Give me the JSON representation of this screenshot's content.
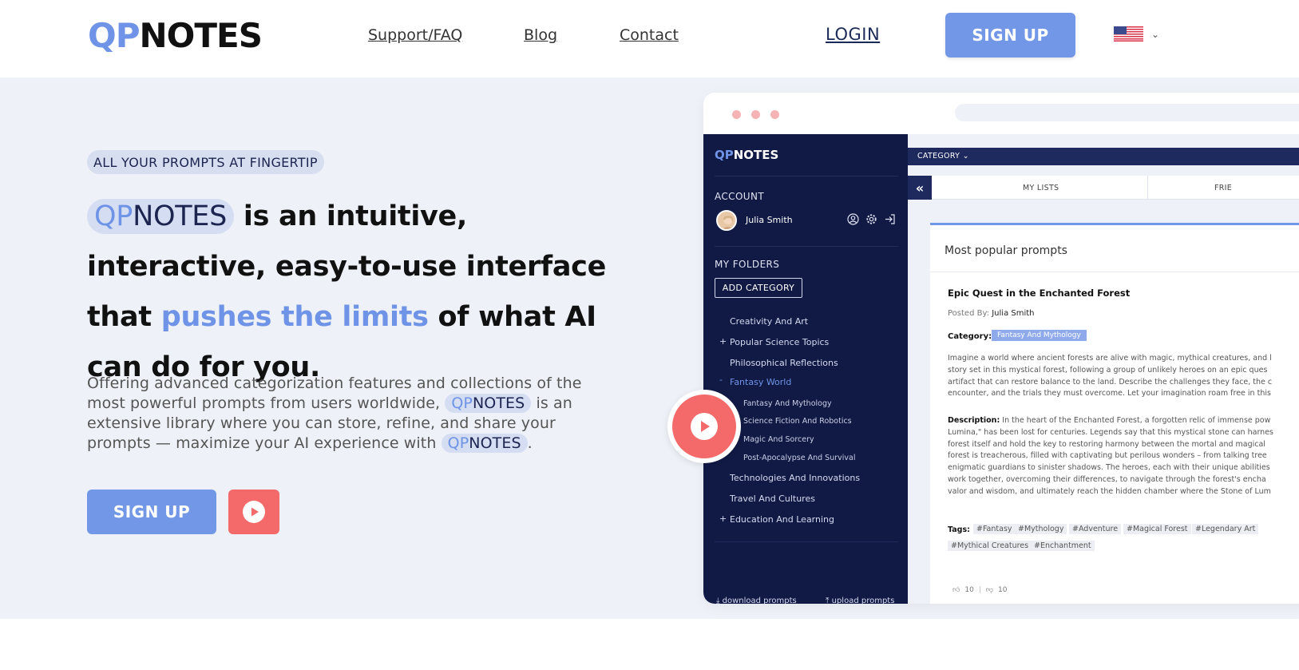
{
  "header": {
    "logo_qp": "QP",
    "logo_notes": "NOTES",
    "nav": [
      "Support/FAQ",
      "Blog",
      "Contact"
    ],
    "login": "LOGIN",
    "signup": "SIGN UP",
    "language_icon": "us-flag-icon"
  },
  "hero": {
    "tagline": "ALL YOUR PROMPTS AT FINGERTIP",
    "headline": {
      "qp": "QP",
      "notes": "NOTES",
      "part1": " is an intuitive, interactive, easy-to-use interface that ",
      "accent": "pushes the limits",
      "part2": " of what AI can do for you."
    },
    "body": {
      "part1": "Offering advanced categorization features and collections of the most powerful prompts from users worldwide, ",
      "qp": "QP",
      "notes": "NOTES",
      "part2": " is an extensive library where you can store, refine, and share your prompts — maximize your AI experience with ",
      "part3": "."
    },
    "signup": "SIGN UP",
    "video_icon": "play-icon"
  },
  "app": {
    "logo_qp": "QP",
    "logo_notes": "NOTES",
    "account_heading": "ACCOUNT",
    "user_name": "Julia Smith",
    "folders_heading": "MY FOLDERS",
    "add_category": "ADD CATEGORY",
    "folders": [
      {
        "label": "Creativity And Art",
        "sign": ""
      },
      {
        "label": "Popular Science Topics",
        "sign": "+"
      },
      {
        "label": "Philosophical Reflections",
        "sign": ""
      },
      {
        "label": "Fantasy World",
        "sign": "-"
      },
      {
        "label": "Fantasy And Mythology",
        "sign": ""
      },
      {
        "label": "Science Fiction And Robotics",
        "sign": ""
      },
      {
        "label": "Magic And Sorcery",
        "sign": ""
      },
      {
        "label": "Post-Apocalypse And Survival",
        "sign": ""
      },
      {
        "label": "Technologies And Innovations",
        "sign": ""
      },
      {
        "label": "Travel And Cultures",
        "sign": ""
      },
      {
        "label": "Education And Learning",
        "sign": "+"
      }
    ],
    "download": "download prompts",
    "upload": "upload prompts",
    "category_label": "CATEGORY",
    "tabs": [
      "MY LISTS",
      "FRIE"
    ],
    "card_title": "Most popular prompts",
    "prompt": {
      "title": "Epic Quest in the Enchanted Forest",
      "posted_label": "Posted By:",
      "posted_by": "Julia Smith",
      "category_label": "Category:",
      "category": "Fantasy And Mythology",
      "intro_lines": [
        "Imagine a world where ancient forests are alive with magic, mythical creatures, and l",
        "story set in this mystical forest, following a group of unlikely heroes on an epic ques",
        "artifact that can restore balance to the land. Describe the challenges they face, the c",
        "encounter, and the trials they must overcome. Let your imagination roam free in this"
      ],
      "description_label": "Description:",
      "description_lines": [
        " In the heart of the Enchanted Forest, a forgotten relic of immense pow",
        "Lumina,\" has been lost for centuries. Legends say that this mystical stone can harnes",
        "forest itself and hold the key to restoring harmony between the mortal and magical",
        "forest is treacherous, filled with captivating but perilous wonders – from talking tree",
        "enigmatic guardians to sinister shadows. The heroes, each with their unique abilities",
        "work together, overcoming their differences, to navigate through the forest's encha",
        "valor and wisdom, and ultimately reach the hidden chamber where the Stone of Lum"
      ],
      "tags_label": "Tags:",
      "tags": [
        "#Fantasy",
        "#Mythology",
        "#Adventure",
        "#Magical Forest",
        "#Legendary Art",
        "#Mythical Creatures",
        "#Enchantment"
      ],
      "likes": "10",
      "dislikes": "10"
    }
  },
  "colors": {
    "accent": "#7297e7",
    "dark_navy": "#111a45",
    "red": "#f46a6a",
    "hero_bg": "#eef1f7"
  }
}
